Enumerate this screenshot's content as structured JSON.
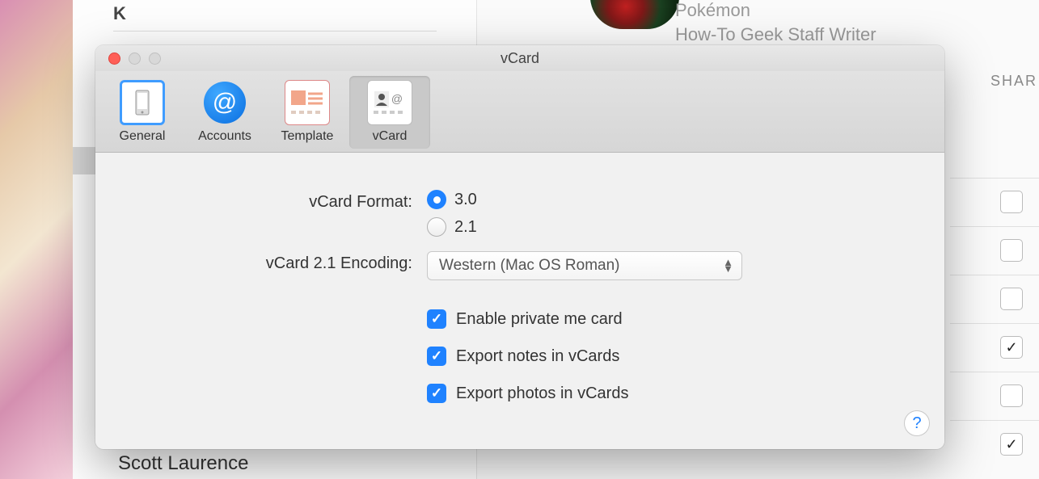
{
  "background": {
    "section_letter": "K",
    "avatar_colors": "red-green",
    "right_line1": "Pokémon",
    "right_line2": "How-To Geek  Staff Writer",
    "share_label": "SHAR",
    "bottom_contact": "Scott Laurence",
    "right_checkboxes": [
      {
        "checked": false
      },
      {
        "checked": false
      },
      {
        "checked": false
      },
      {
        "checked": true
      },
      {
        "checked": false
      },
      {
        "checked": true
      }
    ]
  },
  "dialog": {
    "title": "vCard",
    "toolbar": {
      "items": [
        {
          "label": "General",
          "active": false
        },
        {
          "label": "Accounts",
          "active": false
        },
        {
          "label": "Template",
          "active": false
        },
        {
          "label": "vCard",
          "active": true
        }
      ]
    },
    "vcard_format": {
      "label": "vCard Format:",
      "options": [
        {
          "label": "3.0",
          "selected": true
        },
        {
          "label": "2.1",
          "selected": false
        }
      ]
    },
    "encoding": {
      "label": "vCard 2.1 Encoding:",
      "selected": "Western (Mac OS Roman)"
    },
    "checks": [
      {
        "label": "Enable private me card",
        "checked": true
      },
      {
        "label": "Export notes in vCards",
        "checked": true
      },
      {
        "label": "Export photos in vCards",
        "checked": true
      }
    ],
    "help": "?"
  }
}
